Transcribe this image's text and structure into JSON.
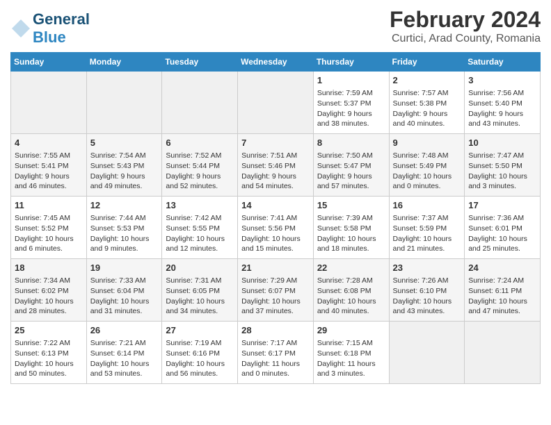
{
  "header": {
    "logo_general": "General",
    "logo_blue": "Blue",
    "main_title": "February 2024",
    "subtitle": "Curtici, Arad County, Romania"
  },
  "columns": [
    "Sunday",
    "Monday",
    "Tuesday",
    "Wednesday",
    "Thursday",
    "Friday",
    "Saturday"
  ],
  "weeks": [
    [
      {
        "day": "",
        "content": ""
      },
      {
        "day": "",
        "content": ""
      },
      {
        "day": "",
        "content": ""
      },
      {
        "day": "",
        "content": ""
      },
      {
        "day": "1",
        "content": "Sunrise: 7:59 AM\nSunset: 5:37 PM\nDaylight: 9 hours\nand 38 minutes."
      },
      {
        "day": "2",
        "content": "Sunrise: 7:57 AM\nSunset: 5:38 PM\nDaylight: 9 hours\nand 40 minutes."
      },
      {
        "day": "3",
        "content": "Sunrise: 7:56 AM\nSunset: 5:40 PM\nDaylight: 9 hours\nand 43 minutes."
      }
    ],
    [
      {
        "day": "4",
        "content": "Sunrise: 7:55 AM\nSunset: 5:41 PM\nDaylight: 9 hours\nand 46 minutes."
      },
      {
        "day": "5",
        "content": "Sunrise: 7:54 AM\nSunset: 5:43 PM\nDaylight: 9 hours\nand 49 minutes."
      },
      {
        "day": "6",
        "content": "Sunrise: 7:52 AM\nSunset: 5:44 PM\nDaylight: 9 hours\nand 52 minutes."
      },
      {
        "day": "7",
        "content": "Sunrise: 7:51 AM\nSunset: 5:46 PM\nDaylight: 9 hours\nand 54 minutes."
      },
      {
        "day": "8",
        "content": "Sunrise: 7:50 AM\nSunset: 5:47 PM\nDaylight: 9 hours\nand 57 minutes."
      },
      {
        "day": "9",
        "content": "Sunrise: 7:48 AM\nSunset: 5:49 PM\nDaylight: 10 hours\nand 0 minutes."
      },
      {
        "day": "10",
        "content": "Sunrise: 7:47 AM\nSunset: 5:50 PM\nDaylight: 10 hours\nand 3 minutes."
      }
    ],
    [
      {
        "day": "11",
        "content": "Sunrise: 7:45 AM\nSunset: 5:52 PM\nDaylight: 10 hours\nand 6 minutes."
      },
      {
        "day": "12",
        "content": "Sunrise: 7:44 AM\nSunset: 5:53 PM\nDaylight: 10 hours\nand 9 minutes."
      },
      {
        "day": "13",
        "content": "Sunrise: 7:42 AM\nSunset: 5:55 PM\nDaylight: 10 hours\nand 12 minutes."
      },
      {
        "day": "14",
        "content": "Sunrise: 7:41 AM\nSunset: 5:56 PM\nDaylight: 10 hours\nand 15 minutes."
      },
      {
        "day": "15",
        "content": "Sunrise: 7:39 AM\nSunset: 5:58 PM\nDaylight: 10 hours\nand 18 minutes."
      },
      {
        "day": "16",
        "content": "Sunrise: 7:37 AM\nSunset: 5:59 PM\nDaylight: 10 hours\nand 21 minutes."
      },
      {
        "day": "17",
        "content": "Sunrise: 7:36 AM\nSunset: 6:01 PM\nDaylight: 10 hours\nand 25 minutes."
      }
    ],
    [
      {
        "day": "18",
        "content": "Sunrise: 7:34 AM\nSunset: 6:02 PM\nDaylight: 10 hours\nand 28 minutes."
      },
      {
        "day": "19",
        "content": "Sunrise: 7:33 AM\nSunset: 6:04 PM\nDaylight: 10 hours\nand 31 minutes."
      },
      {
        "day": "20",
        "content": "Sunrise: 7:31 AM\nSunset: 6:05 PM\nDaylight: 10 hours\nand 34 minutes."
      },
      {
        "day": "21",
        "content": "Sunrise: 7:29 AM\nSunset: 6:07 PM\nDaylight: 10 hours\nand 37 minutes."
      },
      {
        "day": "22",
        "content": "Sunrise: 7:28 AM\nSunset: 6:08 PM\nDaylight: 10 hours\nand 40 minutes."
      },
      {
        "day": "23",
        "content": "Sunrise: 7:26 AM\nSunset: 6:10 PM\nDaylight: 10 hours\nand 43 minutes."
      },
      {
        "day": "24",
        "content": "Sunrise: 7:24 AM\nSunset: 6:11 PM\nDaylight: 10 hours\nand 47 minutes."
      }
    ],
    [
      {
        "day": "25",
        "content": "Sunrise: 7:22 AM\nSunset: 6:13 PM\nDaylight: 10 hours\nand 50 minutes."
      },
      {
        "day": "26",
        "content": "Sunrise: 7:21 AM\nSunset: 6:14 PM\nDaylight: 10 hours\nand 53 minutes."
      },
      {
        "day": "27",
        "content": "Sunrise: 7:19 AM\nSunset: 6:16 PM\nDaylight: 10 hours\nand 56 minutes."
      },
      {
        "day": "28",
        "content": "Sunrise: 7:17 AM\nSunset: 6:17 PM\nDaylight: 11 hours\nand 0 minutes."
      },
      {
        "day": "29",
        "content": "Sunrise: 7:15 AM\nSunset: 6:18 PM\nDaylight: 11 hours\nand 3 minutes."
      },
      {
        "day": "",
        "content": ""
      },
      {
        "day": "",
        "content": ""
      }
    ]
  ]
}
